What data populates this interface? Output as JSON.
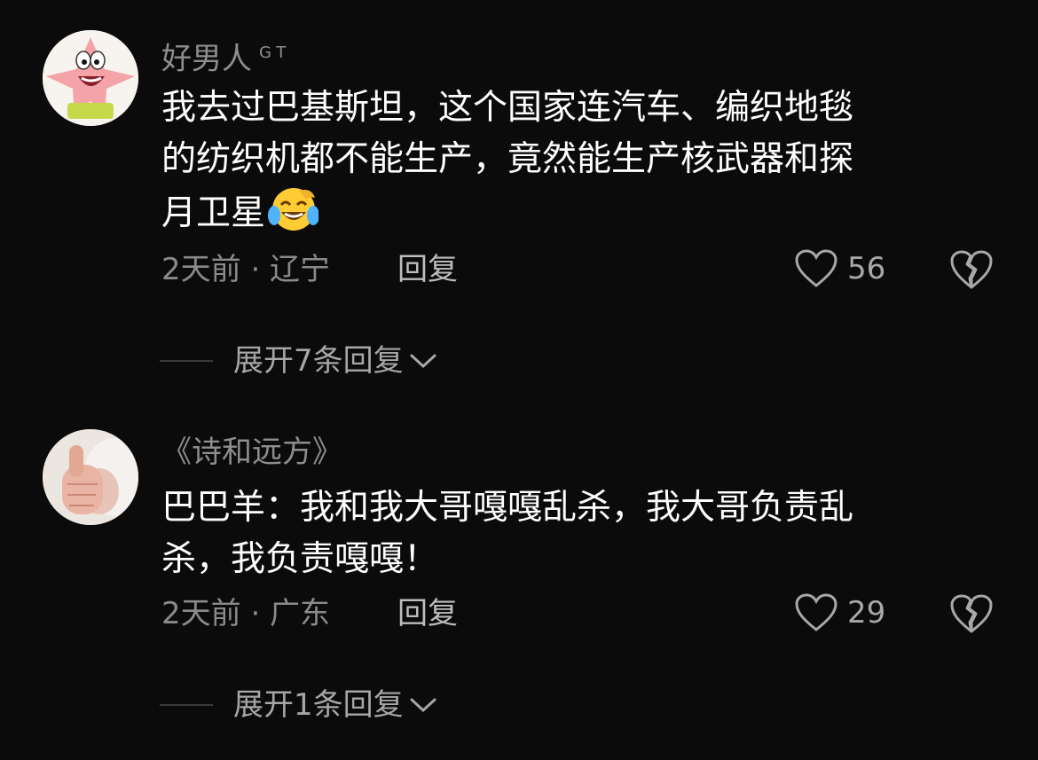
{
  "comments": [
    {
      "username": "好男人",
      "badge": "GT",
      "text_lines": [
        "我去过巴基斯坦，这个国家连汽车、编织地毯",
        "的纺织机都不能生产，竟然能生产核武器和探",
        "月卫星"
      ],
      "emoji": "laughing-crying-emoji",
      "time_location": "2天前 · 辽宁",
      "reply_label": "回复",
      "likes": "56",
      "expand_label": "展开7条回复"
    },
    {
      "username": "《诗和远方》",
      "badge": "",
      "text_lines": [
        "巴巴羊：我和我大哥嘎嘎乱杀，我大哥负责乱",
        "杀，我负责嘎嘎！"
      ],
      "time_location": "2天前 · 广东",
      "reply_label": "回复",
      "likes": "29",
      "expand_label": "展开1条回复"
    }
  ],
  "colors": {
    "background": "#0b0b0b",
    "text": "#ffffff",
    "muted": "#8e8e8e"
  }
}
